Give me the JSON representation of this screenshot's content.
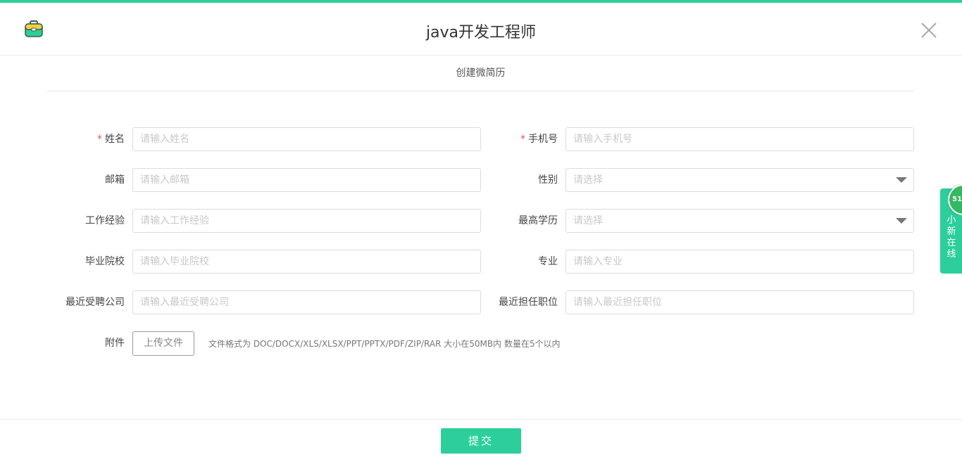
{
  "header": {
    "title": "java开发工程师",
    "logo_icon": "briefcase-icon",
    "close_icon": "close-icon"
  },
  "subtitle": "创建微简历",
  "form": {
    "name": {
      "label": "姓名",
      "required": "*",
      "placeholder": "请输入姓名"
    },
    "phone": {
      "label": "手机号",
      "required": "*",
      "placeholder": "请输入手机号"
    },
    "email": {
      "label": "邮箱",
      "placeholder": "请输入邮箱"
    },
    "gender": {
      "label": "性别",
      "placeholder": "请选择"
    },
    "experience": {
      "label": "工作经验",
      "placeholder": "请输入工作经验"
    },
    "education": {
      "label": "最高学历",
      "placeholder": "请选择"
    },
    "school": {
      "label": "毕业院校",
      "placeholder": "请输入毕业院校"
    },
    "major": {
      "label": "专业",
      "placeholder": "请输入专业"
    },
    "company": {
      "label": "最近受聘公司",
      "placeholder": "请输入最近受聘公司"
    },
    "position": {
      "label": "最近担任职位",
      "placeholder": "请输入最近担任职位"
    },
    "attachment": {
      "label": "附件",
      "button": "上传文件",
      "hint": "文件格式为 DOC/DOCX/XLS/XLSX/PPT/PPTX/PDF/ZIP/RAR 大小在50MB内 数量在5个以内"
    }
  },
  "footer": {
    "submit": "提交"
  },
  "side_widget": {
    "badge": "51",
    "text": "小新在线"
  },
  "colors": {
    "accent": "#2ccf9b",
    "required": "#f05050"
  }
}
